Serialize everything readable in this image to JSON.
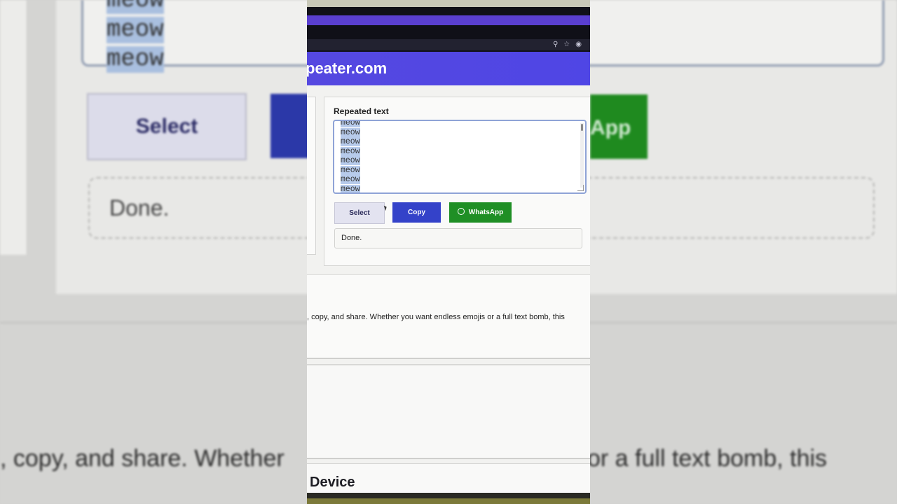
{
  "background_zoom": {
    "textarea_lines": [
      "meow",
      "meow",
      "meow"
    ],
    "select_label": "Select",
    "whatsapp_label": "App",
    "status_text": "Done.",
    "paragraph_left": ", copy, and share. Whether",
    "paragraph_right": "or a full text bomb, this"
  },
  "browser": {
    "icons": [
      "zoom-icon",
      "star-icon",
      "extension-icon"
    ]
  },
  "site": {
    "title": "peater.com",
    "header_color": "#4f46e5"
  },
  "repeater": {
    "label": "Repeated text",
    "output_lines": [
      "meow",
      "meow",
      "meow",
      "meow",
      "meow",
      "meow",
      "meow",
      "meow"
    ],
    "buttons": {
      "select": "Select",
      "copy": "Copy",
      "whatsapp": "WhatsApp"
    },
    "status": "Done."
  },
  "colors": {
    "copy_button": "#3442c9",
    "whatsapp_button": "#1f8f25",
    "select_button": "#e3e3f0"
  },
  "description": ", copy, and share. Whether you want endless emojis or a full text bomb, this",
  "next_section_title": "Device"
}
